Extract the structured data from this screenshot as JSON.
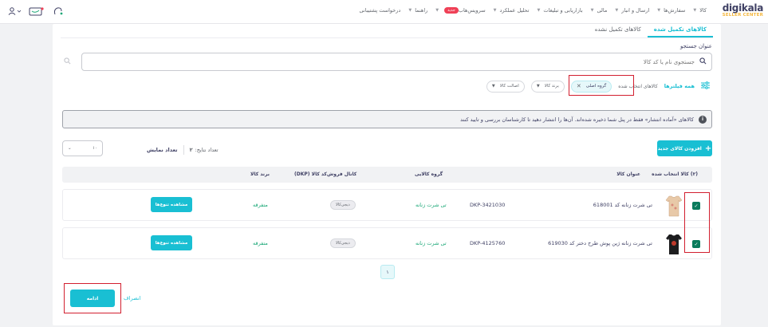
{
  "header": {
    "logo_brand": "digikala",
    "logo_sub": "SELLER CENTER",
    "nav": [
      {
        "label": "کالا"
      },
      {
        "label": "سفارش‌ها"
      },
      {
        "label": "ارسال و انبار"
      },
      {
        "label": "مالی"
      },
      {
        "label": "بازاریابی و تبلیغات"
      },
      {
        "label": "تحلیل عملکرد"
      },
      {
        "label": "سرویس‌هاب",
        "badge": "جدید"
      },
      {
        "label": "راهنما"
      },
      {
        "label": "درخواست پشتیبانی"
      }
    ],
    "icons": [
      "user-icon",
      "gift-icon",
      "notification-icon"
    ]
  },
  "tabs": [
    {
      "label": "کالاهای تکمیل شده",
      "active": true
    },
    {
      "label": "کالاهای تکمیل نشده",
      "active": false
    }
  ],
  "search": {
    "label": "عنوان جستجو",
    "placeholder": "جستجوی نام یا کد کالا"
  },
  "filters": {
    "all_label": "همه فیلترها",
    "selected_label": "کالاهای انتخاب شده",
    "chips": [
      {
        "label": "گروه اصلی",
        "active": true
      },
      {
        "label": "برند کالا",
        "active": false
      },
      {
        "label": "اصالت کالا",
        "active": false
      }
    ]
  },
  "alert": {
    "text": "کالاهای «آماده انتشار» فقط در پنل شما ذخیره شده‌اند. آن‌ها را انتشار دهید تا کارشناسان بررسی و تایید کنند"
  },
  "toolbar": {
    "add_label": "افزودن کالای جدید",
    "results_label": "تعداد نتایج:",
    "results_value": "۲",
    "display_label": "تعداد نمایش",
    "display_value": "۱۰"
  },
  "table": {
    "headers": {
      "selected": "(۲) کالا انتخاب شده",
      "title": "عنوان کالا",
      "dkp": "کد کالا (DKP)",
      "group": "گروه کالایی",
      "channel": "کانال فروش",
      "brand": "برند کالا"
    },
    "rows": [
      {
        "name": "تی شرت زنانه کد 618001",
        "dkp": "DKP-3421030",
        "group": "تی شرت زنانه",
        "channel": "دیجی‌کالا",
        "brand": "متفرقه",
        "action": "مشاهده تنوع‌ها",
        "checked": true,
        "thumb_color": "#e8c9a8"
      },
      {
        "name": "تی شرت زنانه ژین پوش طرح دختر کد 619030",
        "dkp": "DKP-4125760",
        "group": "تی شرت زنانه",
        "channel": "دیجی‌کالا",
        "brand": "متفرقه",
        "action": "مشاهده تنوع‌ها",
        "checked": true,
        "thumb_color": "#1c1c1e"
      }
    ]
  },
  "pagination": {
    "current": "۱"
  },
  "footer": {
    "continue_label": "ادامه",
    "cancel_label": "انصراف"
  },
  "colors": {
    "accent": "#19bfd3",
    "highlight": "#d21f2f",
    "checkbox": "#0a7b5c"
  }
}
